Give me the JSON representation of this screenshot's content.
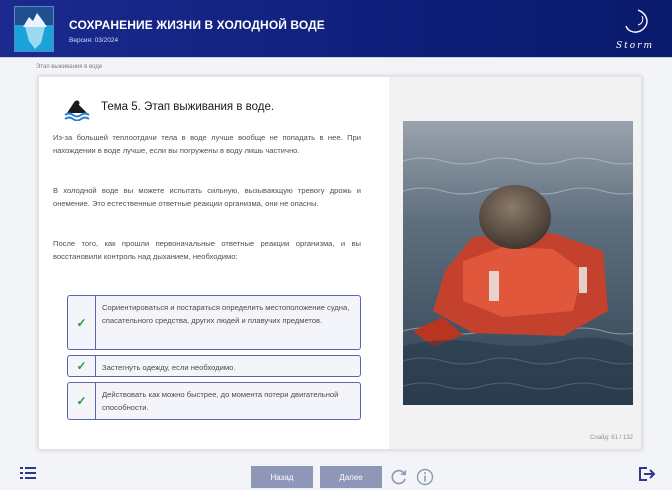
{
  "header": {
    "title": "СОХРАНЕНИЕ ЖИЗНИ В ХОЛОДНОЙ ВОДЕ",
    "version": "Версия: 03/2024",
    "brand_logo_text": "Storm",
    "background_color": "#0d1f7a"
  },
  "breadcrumb": "Этап выживания в воде",
  "content": {
    "topic_title": "Тема 5. Этап выживания в воде.",
    "paragraphs": [
      "Из-за большей теплоотдачи тела в воде лучше вообще не попадать в нее. При нахождении в воде лучше, если вы погружены в воду лишь частично.",
      "В холодной воде вы можете испытать сильную, вызывающую тревогу дрожь и онемение. Это естественные ответные реакции организма, они не опасны.",
      "После того, как прошли первоначальные ответные реакции организма, и вы восстановили контроль над дыханием, необходимо:"
    ],
    "checklist": [
      "Сориентироваться и постараться определить местоположение судна, спасательного средства, других людей и плавучих предметов.",
      "Застегнуть одежду, если необходимо.",
      "Действовать как можно быстрее, до момента потери двигательной способности."
    ],
    "check_color": "#2a9a33",
    "photo_icon": "person-in-lifejacket-in-water-image"
  },
  "slide_counter": "Слайд: 61 / 132",
  "footer": {
    "back_label": "Назад",
    "next_label": "Далее",
    "menu_icon": "list-menu-icon",
    "reload_icon": "reload-icon",
    "info_icon": "info-icon",
    "exit_icon": "exit-icon",
    "button_color": "#8e97b7"
  }
}
